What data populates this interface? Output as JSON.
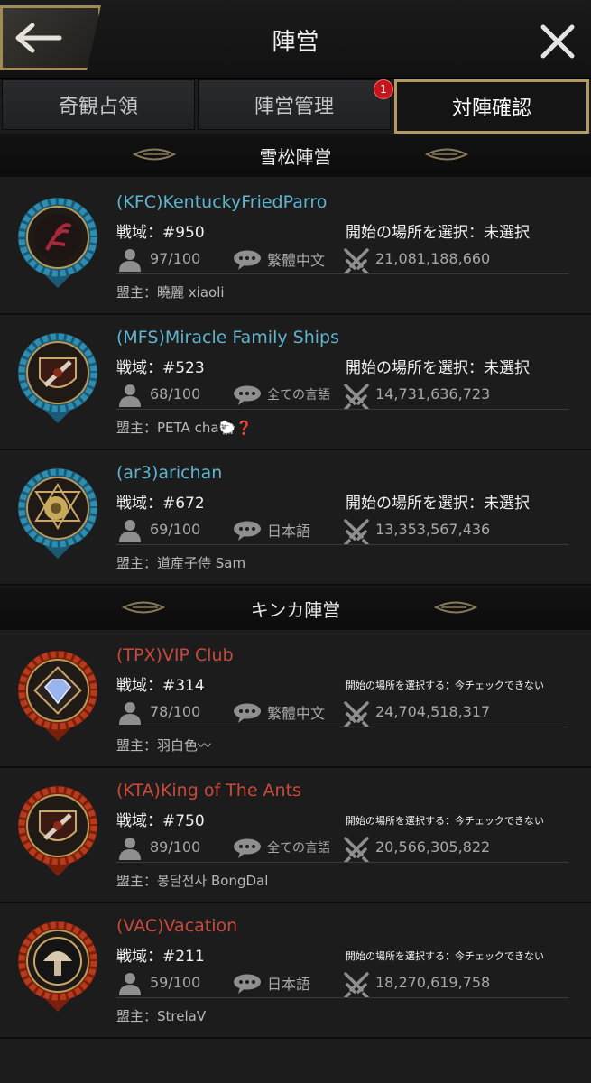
{
  "header": {
    "title": "陣営"
  },
  "tabs": [
    {
      "label": "奇観占領"
    },
    {
      "label": "陣営管理",
      "badge": "1"
    },
    {
      "label": "対陣確認"
    }
  ],
  "factions": [
    {
      "name": "雪松陣営"
    },
    {
      "name": "キンカ陣営"
    }
  ],
  "labels": {
    "server_prefix": "戦域：",
    "leader_prefix": "盟主："
  },
  "alliances": [
    {
      "name": "(KFC)KentuckyFriedParro",
      "server": "#950",
      "start": "開始の場所を選択：未選択",
      "members": "97/100",
      "language": "繁體中文",
      "power": "21,081,188,660",
      "leader": "曉麗 xiaoli",
      "color": "#5fb4ce",
      "emblem": "scorpion-emblem"
    },
    {
      "name": "(MFS)Miracle Family Ships",
      "server": "#523",
      "start": "開始の場所を選択：未選択",
      "members": "68/100",
      "language": "全ての言語",
      "power": "14,731,636,723",
      "leader": "PETA cha🐑❓",
      "color": "#5fb4ce",
      "emblem": "ant-shield-emblem"
    },
    {
      "name": "(ar3)arichan",
      "server": "#672",
      "start": "開始の場所を選択：未選択",
      "members": "69/100",
      "language": "日本語",
      "power": "13,353,567,436",
      "leader": "道産子侍 Sam",
      "color": "#5fb4ce",
      "emblem": "snail-emblem"
    },
    {
      "name": "(TPX)VIP Club",
      "server": "#314",
      "start": "開始の場所を選択する：今チェックできない",
      "members": "78/100",
      "language": "繁體中文",
      "power": "24,704,518,317",
      "leader": "羽白色〰",
      "color": "#c94a3c",
      "emblem": "diamond-emblem"
    },
    {
      "name": "(KTA)King of The Ants",
      "server": "#750",
      "start": "開始の場所を選択する：今チェックできない",
      "members": "89/100",
      "language": "全ての言語",
      "power": "20,566,305,822",
      "leader": "봉달전사 BongDal",
      "color": "#c94a3c",
      "emblem": "ant-shield-emblem"
    },
    {
      "name": "(VAC)Vacation",
      "server": "#211",
      "start": "開始の場所を選択する：今チェックできない",
      "members": "59/100",
      "language": "日本語",
      "power": "18,270,619,758",
      "leader": "StrelaV",
      "color": "#c94a3c",
      "emblem": "mushroom-emblem"
    }
  ],
  "colors": {
    "accent_gold": "#b39a62",
    "blue_faction": "#5fb4ce",
    "red_faction": "#c94a3c",
    "background": "#1c1c1d"
  }
}
